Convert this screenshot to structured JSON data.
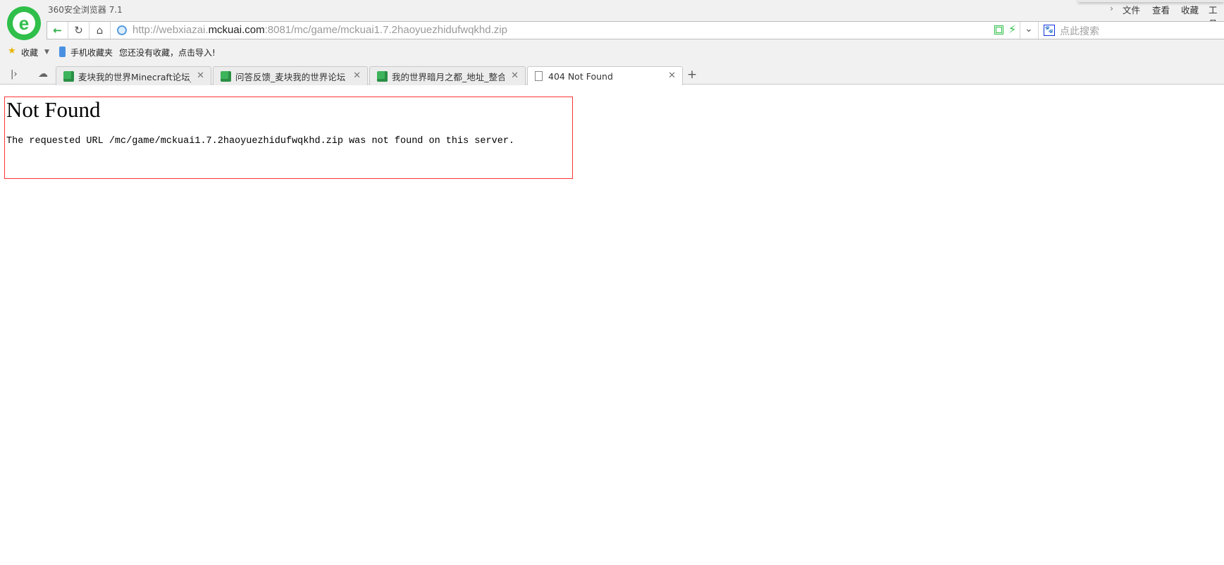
{
  "window": {
    "title": "360安全浏览器 7.1",
    "menu": [
      "文件",
      "查看",
      "收藏",
      "工具"
    ]
  },
  "address_bar": {
    "url_prefix": "http://webxiazai.",
    "url_domain": "mckuai.com",
    "url_suffix": ":8081/mc/game/mckuai1.7.2haoyuezhidufwqkhd.zip",
    "search_placeholder": "点此搜索"
  },
  "bookmarks": {
    "favorites_label": "收藏",
    "mobile_label": "手机收藏夹",
    "empty_hint": "您还没有收藏，点击导入!"
  },
  "tabs": [
    {
      "label": "麦块我的世界Minecraft论坛_社",
      "active": false
    },
    {
      "label": "问答反馈_麦块我的世界论坛",
      "active": false
    },
    {
      "label": "我的世界暗月之都_地址_整合包",
      "active": false
    },
    {
      "label": "404 Not Found",
      "active": true
    }
  ],
  "page": {
    "heading": "Not Found",
    "message": "The requested URL /mc/game/mckuai1.7.2haoyuezhidufwqkhd.zip was not found on this server."
  },
  "colors": {
    "brand": "#2fbf4a",
    "highlight_border": "#ff3333"
  }
}
